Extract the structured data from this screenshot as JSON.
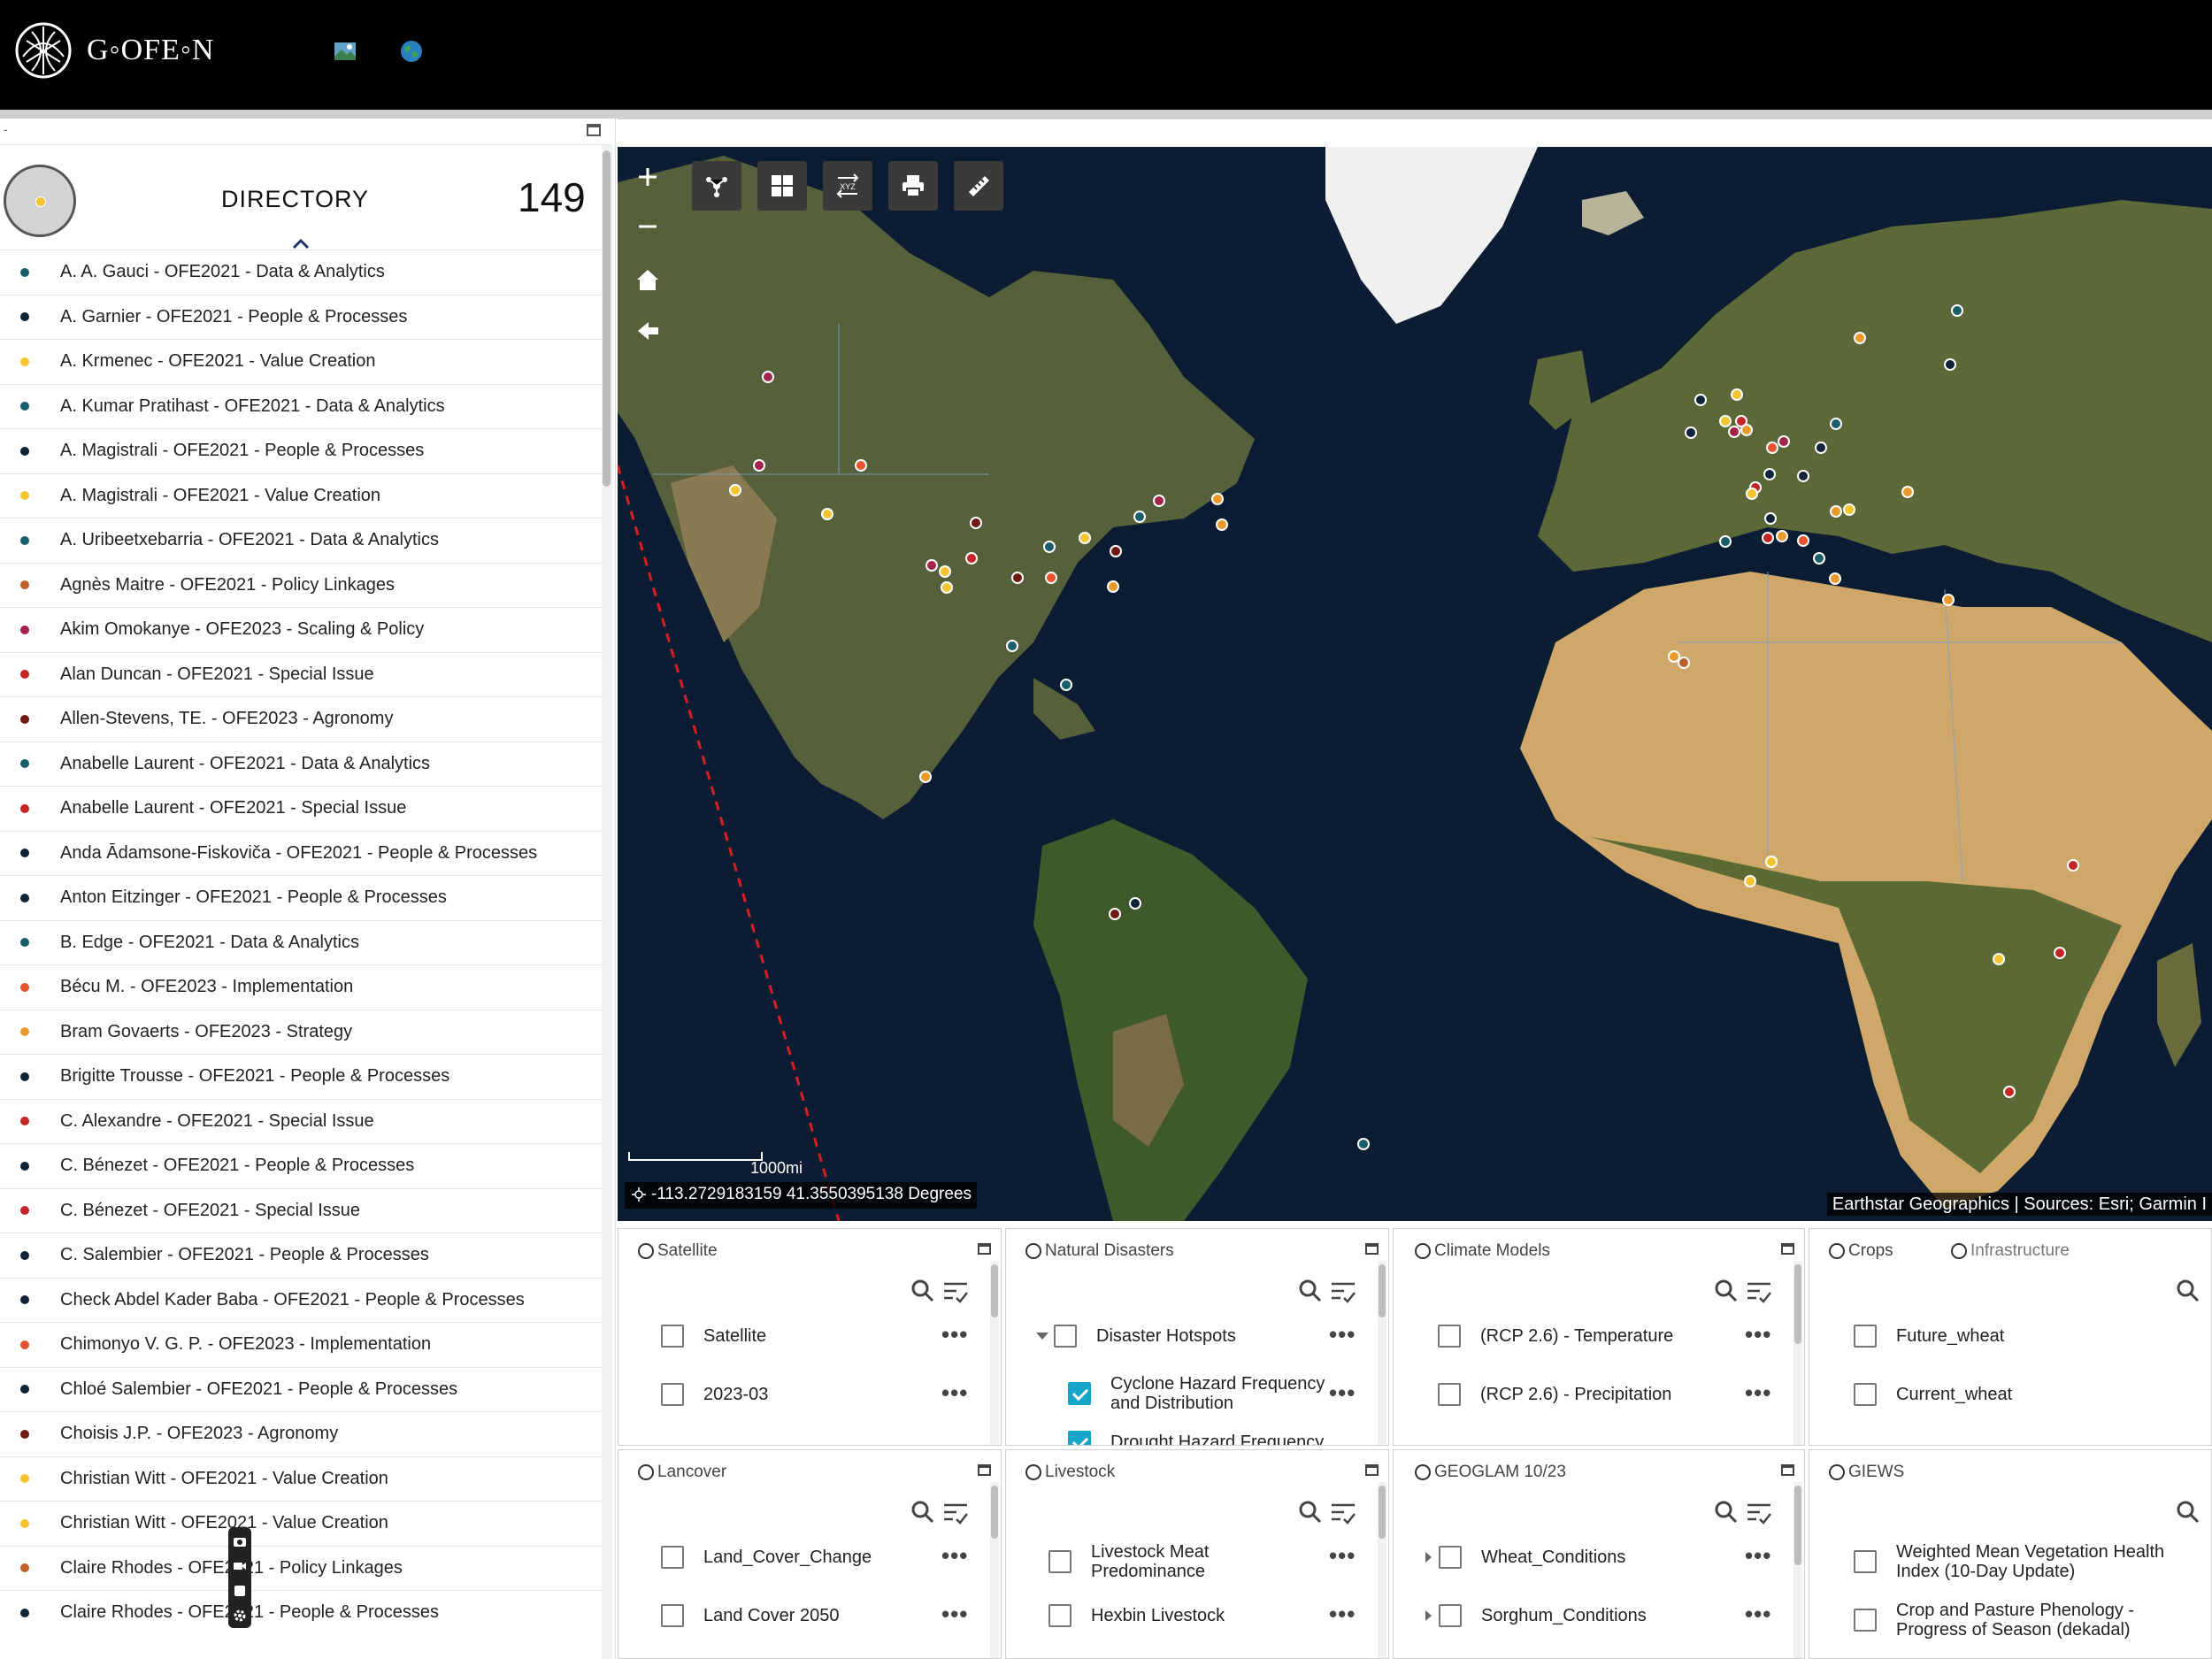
{
  "header": {
    "logo_text": "G◦OFE◦N",
    "icons": [
      "map-landscape-icon",
      "globe-icon"
    ]
  },
  "directory": {
    "dash": "-",
    "title": "DIRECTORY",
    "count": "149",
    "items": [
      {
        "label": "A. A. Gauci - OFE2021 - Data & Analytics",
        "color": "#1a5d6b"
      },
      {
        "label": "A. Garnier - OFE2021 - People & Processes",
        "color": "#0f2338"
      },
      {
        "label": "A. Krmenec - OFE2021 - Value Creation",
        "color": "#f5c431"
      },
      {
        "label": "A. Kumar Pratihast - OFE2021 - Data & Analytics",
        "color": "#1a5d6b"
      },
      {
        "label": "A. Magistrali - OFE2021 - People & Processes",
        "color": "#0f2338"
      },
      {
        "label": "A. Magistrali - OFE2021 - Value Creation",
        "color": "#f5c431"
      },
      {
        "label": "A. Uribeetxebarria - OFE2021 - Data & Analytics",
        "color": "#1a5d6b"
      },
      {
        "label": "Agnès Maitre - OFE2021 - Policy Linkages",
        "color": "#c0612b"
      },
      {
        "label": "Akim Omokanye - OFE2023 - Scaling & Policy",
        "color": "#a3234a"
      },
      {
        "label": "Alan Duncan - OFE2021 - Special Issue",
        "color": "#c42525"
      },
      {
        "label": "Allen-Stevens, TE. - OFE2023 - Agronomy",
        "color": "#6e1a12"
      },
      {
        "label": "Anabelle Laurent - OFE2021 - Data & Analytics",
        "color": "#1a5d6b"
      },
      {
        "label": "Anabelle Laurent - OFE2021 - Special Issue",
        "color": "#c42525"
      },
      {
        "label": "Anda Ādamsone-Fiskoviča - OFE2021 - People & Processes",
        "color": "#0f2338"
      },
      {
        "label": "Anton Eitzinger - OFE2021 - People & Processes",
        "color": "#0f2338"
      },
      {
        "label": "B. Edge - OFE2021 - Data & Analytics",
        "color": "#1a5d6b"
      },
      {
        "label": "Bécu M. - OFE2023 - Implementation",
        "color": "#e5532f"
      },
      {
        "label": "Bram Govaerts - OFE2023 - Strategy",
        "color": "#e89a2c"
      },
      {
        "label": "Brigitte Trousse - OFE2021 - People & Processes",
        "color": "#0f2338"
      },
      {
        "label": "C. Alexandre - OFE2021 - Special Issue",
        "color": "#c42525"
      },
      {
        "label": "C. Bénezet - OFE2021 - People & Processes",
        "color": "#0f2338"
      },
      {
        "label": "C. Bénezet - OFE2021 - Special Issue",
        "color": "#c42525"
      },
      {
        "label": "C. Salembier - OFE2021 - People & Processes",
        "color": "#0f2338"
      },
      {
        "label": "Check Abdel Kader Baba - OFE2021 - People & Processes",
        "color": "#0f2338"
      },
      {
        "label": "Chimonyo V. G. P. - OFE2023 - Implementation",
        "color": "#e5532f"
      },
      {
        "label": "Chloé Salembier - OFE2021 - People & Processes",
        "color": "#0f2338"
      },
      {
        "label": "Choisis J.P. - OFE2023 - Agronomy",
        "color": "#6e1a12"
      },
      {
        "label": "Christian Witt - OFE2021 - Value Creation",
        "color": "#f5c431"
      },
      {
        "label": "Christian Witt - OFE2021 - Value Creation",
        "color": "#f5c431"
      },
      {
        "label": "Claire Rhodes - OFE2021 - Policy Linkages",
        "color": "#c0612b"
      },
      {
        "label": "Claire Rhodes - OFE2021 - People & Processes",
        "color": "#0f2338"
      }
    ]
  },
  "map": {
    "toolbar": [
      "zoom-in",
      "zoom-out",
      "home",
      "back",
      "basemap-gallery",
      "layer-grid",
      "xyz-tiles",
      "print",
      "measure"
    ],
    "xyz_label": "XYZ",
    "scale_label": "1000mi",
    "coordinates": "-113.2729183159 41.3550395138 Degrees",
    "attribution": "Earthstar Geographics | Sources: Esri; Garmin I",
    "colors": {
      "ocean": "#0c1c33",
      "land": "#4f5a32",
      "desert": "#c9a56a",
      "ice": "#f2f2f2",
      "border": "#7ea2c8"
    }
  },
  "panels": {
    "satellite": {
      "title": "Satellite",
      "layers": [
        "Satellite",
        "2023-03"
      ]
    },
    "disasters": {
      "title": "Natural Disasters",
      "layers": [
        "Disaster Hotspots",
        "Cyclone Hazard Frequency and Distribution",
        "Drought Hazard Frequency"
      ]
    },
    "climate": {
      "title": "Climate Models",
      "layers": [
        "(RCP 2.6) - Temperature",
        "(RCP 2.6) - Precipitation"
      ]
    },
    "crops": {
      "title": "Crops",
      "title2": "Infrastructure",
      "layers": [
        "Future_wheat",
        "Current_wheat"
      ]
    },
    "lancover": {
      "title": "Lancover",
      "layers": [
        "Land_Cover_Change",
        "Land Cover 2050"
      ]
    },
    "livestock": {
      "title": "Livestock",
      "layers": [
        "Livestock Meat Predominance",
        "Hexbin Livestock"
      ]
    },
    "geoglam": {
      "title": "GEOGLAM 10/23",
      "layers": [
        "Wheat_Conditions",
        "Sorghum_Conditions"
      ]
    },
    "giews": {
      "title": "GIEWS",
      "layers": [
        "Weighted Mean Vegetation Health Index (10-Day Update)",
        "Crop and Pasture Phenology - Progress of Season (dekadal)"
      ]
    }
  }
}
